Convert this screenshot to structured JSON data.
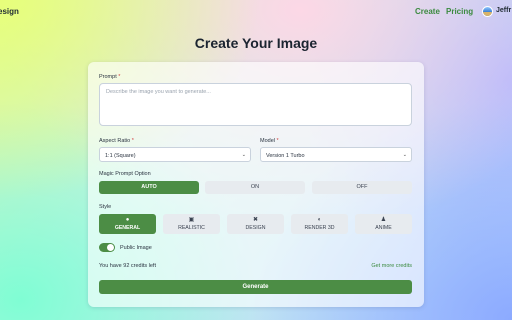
{
  "header": {
    "brand": "esign",
    "nav": {
      "create": "Create",
      "pricing": "Pricing"
    },
    "user_name": "Jeffr"
  },
  "page": {
    "title": "Create Your Image"
  },
  "form": {
    "prompt": {
      "label": "Prompt",
      "required_mark": "*",
      "placeholder": "Describe the image you want to generate...",
      "value": ""
    },
    "aspect_ratio": {
      "label": "Aspect Ratio",
      "required_mark": "*",
      "value": "1:1 (Square)"
    },
    "model": {
      "label": "Model",
      "required_mark": "*",
      "value": "Version 1 Turbo"
    },
    "magic_prompt": {
      "label": "Magic Prompt Option",
      "options": [
        "AUTO",
        "ON",
        "OFF"
      ],
      "selected": "AUTO"
    },
    "style": {
      "label": "Style",
      "options": [
        {
          "label": "GENERAL",
          "icon": "circle-icon"
        },
        {
          "label": "REALISTIC",
          "icon": "camera-icon"
        },
        {
          "label": "DESIGN",
          "icon": "tools-icon"
        },
        {
          "label": "RENDER 3D",
          "icon": "render-icon"
        },
        {
          "label": "ANIME",
          "icon": "person-icon"
        }
      ],
      "selected": "GENERAL"
    },
    "public_image": {
      "label": "Public Image",
      "enabled": true
    },
    "credits_text": "You have 92 credits left",
    "more_credits_label": "Get more credits",
    "generate_label": "Generate"
  },
  "colors": {
    "accent": "#4c8d45",
    "link": "#3b8a3f",
    "required": "#d23b3b"
  }
}
